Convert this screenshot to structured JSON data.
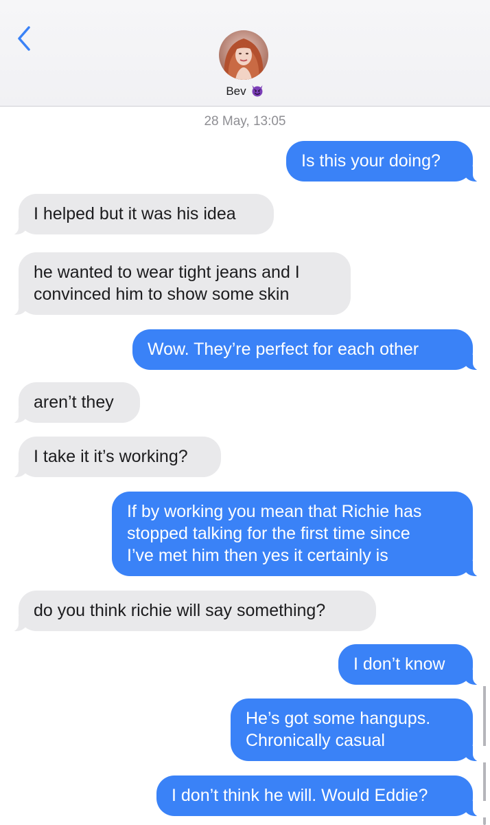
{
  "header": {
    "contact_name": "Bev",
    "contact_emoji": "smiling-devil-icon",
    "back_icon": "chevron-left-icon",
    "accent_color": "#3a82f7"
  },
  "thread": {
    "timestamp": "28 May, 13:05",
    "messages": [
      {
        "direction": "sent",
        "text": "Is this your doing?"
      },
      {
        "direction": "received",
        "text": "I helped but it was his idea"
      },
      {
        "direction": "received",
        "text": "he wanted to wear tight jeans and I\nconvinced him to show some skin"
      },
      {
        "direction": "sent",
        "text": "Wow. They’re perfect for each other"
      },
      {
        "direction": "received",
        "text": "aren’t they"
      },
      {
        "direction": "received",
        "text": "I take it it’s working?"
      },
      {
        "direction": "sent",
        "text": "If by working you mean that Richie has\nstopped talking for the first time since\nI’ve met him then yes it certainly is"
      },
      {
        "direction": "received",
        "text": "do you think richie will say something?"
      },
      {
        "direction": "sent",
        "text": "I don’t know"
      },
      {
        "direction": "sent",
        "text": "He’s got some hangups.\nChronically casual"
      },
      {
        "direction": "sent",
        "text": "I don’t think he will. Would Eddie?"
      }
    ]
  },
  "colors": {
    "sent_bubble": "#3a82f7",
    "received_bubble": "#e9e9eb",
    "timestamp_text": "#8e8e93"
  }
}
